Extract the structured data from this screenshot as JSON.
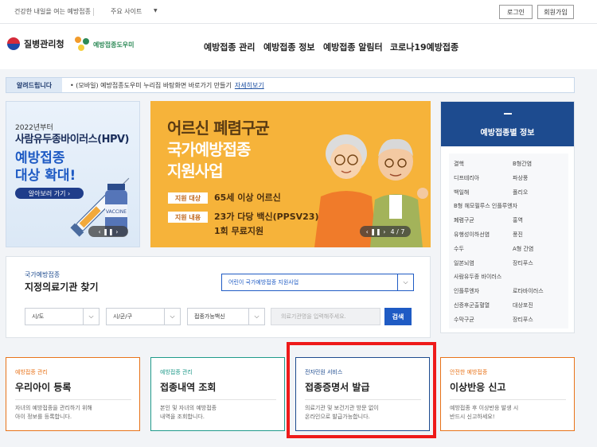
{
  "topbar": {
    "tagline": "건강한 내일을 여는 예방접종",
    "sites_label": "주요 사이트",
    "login": "로그인",
    "signup": "회원가입"
  },
  "header": {
    "agency": "질병관리청",
    "brand": "예방접종도우미",
    "nav": [
      "예방접종 관리",
      "예방접종 정보",
      "예방접종 알림터",
      "코로나19예방접종"
    ]
  },
  "notice": {
    "label": "알려드립니다",
    "message": "(모바일) 예방접종도우미 누리집 바탕화면 바로가기 만들기",
    "link": "자세히보기"
  },
  "banner_hpv": {
    "year": "2022년부터",
    "line2": "사람유두종바이러스(HPV)",
    "line3": "예방접종",
    "line4": "대상 확대!",
    "cta": "알아보러 가기 ›",
    "vial_label": "VACCINE",
    "pager": "‹ ❚❚ ›"
  },
  "banner_elder": {
    "line1": "어르신 폐렴구균",
    "line2": "국가예방접종",
    "line3": "지원사업",
    "tag1": "지원 대상",
    "value1": "65세 이상 어르신",
    "tag2": "지원 내용",
    "value2a": "23가 다당 백신(PPSV23),",
    "value2b": "1회 무료지원",
    "pager_count": "4 / 7",
    "pager_controls": "‹ ❚❚ ›"
  },
  "vaccine_info": {
    "title": "예방접종별 정보",
    "items": [
      [
        "결핵",
        "B형간염"
      ],
      [
        "디프테리아",
        "파상풍"
      ],
      [
        "백일해",
        "폴리오"
      ],
      [
        "B형 헤모필루스 인플루엔자",
        ""
      ],
      [
        "폐렴구균",
        "홍역"
      ],
      [
        "유행성이하선염",
        "풍진"
      ],
      [
        "수두",
        "A형 간염"
      ],
      [
        "일본뇌염",
        "장티푸스"
      ],
      [
        "사람유두종 바이러스",
        ""
      ],
      [
        "인플루엔자",
        "로타바이러스"
      ],
      [
        "신증후군출혈열",
        "대상포진"
      ],
      [
        "수막구균",
        "장티푸스"
      ]
    ]
  },
  "search": {
    "caption": "국가예방접종",
    "title": "지정의료기관 찾기",
    "program_select": "어린이 국가예방접종 지원사업",
    "sido": "시/도",
    "sigungu": "시/군/구",
    "vaccine": "접종가능백신",
    "placeholder": "의료기관명을 입력해주세요.",
    "button": "검색"
  },
  "cards": [
    {
      "category": "예방접종 관리",
      "name": "우리아이 등록",
      "desc1": "자녀의 예방접종을 관리하기 위해",
      "desc2": "아이 정보를 등록합니다.",
      "accent": "#e8731a"
    },
    {
      "category": "예방접종 관리",
      "name": "접종내역 조회",
      "desc1": "본인 및 자녀의 예방접종",
      "desc2": "내역을 조회합니다.",
      "accent": "#1f9a8a"
    },
    {
      "category": "전자민원 서비스",
      "name": "접종증명서 발급",
      "desc1": "의료기관 및 보건기관 방문 없이",
      "desc2": "온라인으로 발급가능합니다.",
      "accent": "#1d4b8f"
    },
    {
      "category": "안전한 예방접종",
      "name": "이상반응 신고",
      "desc1": "예방접종 후 이상반응 발생 시",
      "desc2": "반드시 신고하세요!",
      "accent": "#e8731a"
    }
  ]
}
